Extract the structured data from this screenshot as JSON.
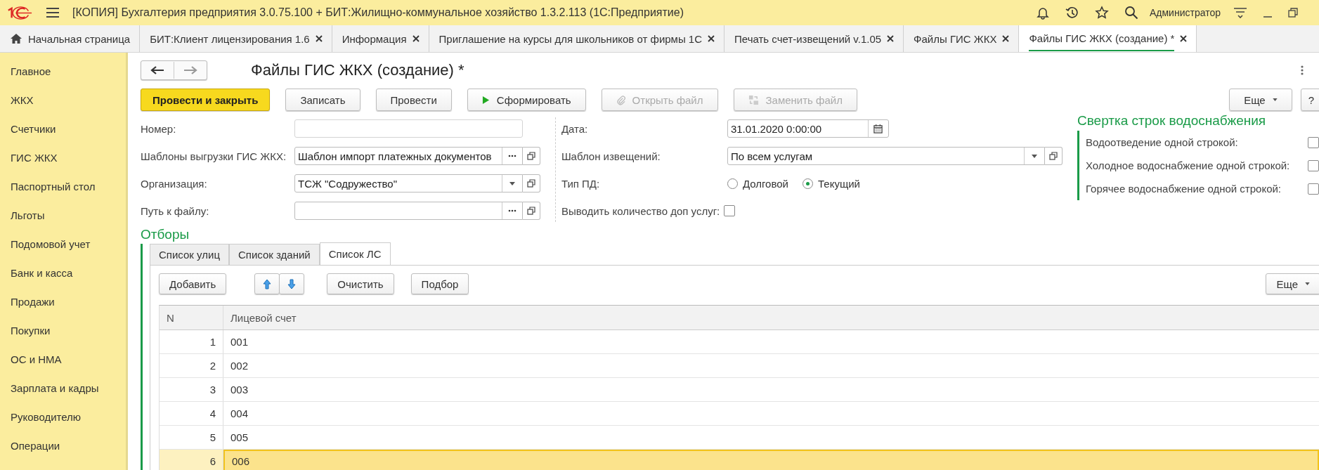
{
  "title_bar": {
    "title": "[КОПИЯ] Бухгалтерия предприятия 3.0.75.100 + БИТ:Жилищно-коммунальное хозяйство 1.3.2.113  (1С:Предприятие)",
    "user": "Администратор"
  },
  "tabs": [
    {
      "label": "Начальная страница",
      "kind": "home",
      "selected": false
    },
    {
      "label": "БИТ:Клиент лицензирования 1.6",
      "kind": "doc",
      "selected": false
    },
    {
      "label": "Информация",
      "kind": "doc",
      "selected": false
    },
    {
      "label": "Приглашение на курсы для школьников от фирмы 1С",
      "kind": "doc",
      "selected": false
    },
    {
      "label": "Печать счет-извещений v.1.05",
      "kind": "doc",
      "selected": false
    },
    {
      "label": "Файлы ГИС ЖКХ",
      "kind": "doc",
      "selected": false
    },
    {
      "label": "Файлы ГИС ЖКХ (создание) *",
      "kind": "doc",
      "selected": true
    }
  ],
  "sidebar": {
    "items": [
      {
        "label": "Главное"
      },
      {
        "label": "ЖКХ"
      },
      {
        "label": "Счетчики"
      },
      {
        "label": "ГИС ЖКХ"
      },
      {
        "label": "Паспортный стол"
      },
      {
        "label": "Льготы"
      },
      {
        "label": "Подомовой учет"
      },
      {
        "label": "Банк и касса"
      },
      {
        "label": "Продажи"
      },
      {
        "label": "Покупки"
      },
      {
        "label": "ОС и НМА"
      },
      {
        "label": "Зарплата и кадры"
      },
      {
        "label": "Руководителю"
      },
      {
        "label": "Операции"
      }
    ]
  },
  "form": {
    "title": "Файлы ГИС ЖКХ (создание) *",
    "buttons": [
      {
        "label": "Провести и закрыть",
        "kind": "primary",
        "disabled": false
      },
      {
        "label": "Записать",
        "kind": "plain",
        "disabled": false
      },
      {
        "label": "Провести",
        "kind": "plain",
        "disabled": false
      },
      {
        "label": "Сформировать",
        "kind": "play",
        "disabled": false
      },
      {
        "label": "Открыть файл",
        "kind": "attach",
        "disabled": true
      },
      {
        "label": "Заменить файл",
        "kind": "replace",
        "disabled": true
      }
    ],
    "more": "Еще",
    "help": "?",
    "left_fields": [
      {
        "label": "Номер:",
        "kind": "text"
      },
      {
        "label": "Шаблоны выгрузки ГИС ЖКХ:",
        "kind": "choice",
        "value": "Шаблон импорт платежных документов"
      },
      {
        "label": "Организация:",
        "kind": "select",
        "value": "ТСЖ \"Содружество\""
      },
      {
        "label": "Путь к файлу:",
        "kind": "choice"
      }
    ],
    "date": {
      "label": "Дата:",
      "value": "31.01.2020  0:00:00"
    },
    "notice_template": {
      "label": "Шаблон извещений:",
      "value": "По всем услугам"
    },
    "pd_type": {
      "label": "Тип ПД:",
      "options": [
        {
          "label": "Долговой",
          "selected": false
        },
        {
          "label": "Текущий",
          "selected": true
        }
      ]
    },
    "extra_count": {
      "label": "Выводить количество доп услуг:",
      "checked": false
    },
    "water_group": {
      "title": "Свертка строк водоснабжения",
      "options": [
        {
          "label": "Водоотведение одной строкой:",
          "checked": false
        },
        {
          "label": "Холодное водоснабжение одной строкой:",
          "checked": false
        },
        {
          "label": "Горячее водоснабжение одной строкой:",
          "checked": false
        }
      ]
    }
  },
  "filters": {
    "title": "Отборы",
    "tabs": [
      {
        "label": "Список улиц",
        "selected": false
      },
      {
        "label": "Список зданий",
        "selected": false
      },
      {
        "label": "Список ЛС",
        "selected": true
      }
    ],
    "toolbar": [
      {
        "label": "Добавить",
        "kind": "text"
      },
      {
        "kind": "up"
      },
      {
        "kind": "down"
      },
      {
        "label": "Очистить",
        "kind": "text"
      },
      {
        "label": "Подбор",
        "kind": "text"
      }
    ],
    "more": "Еще",
    "table": {
      "columns": [
        "N",
        "Лицевой счет"
      ],
      "rows": [
        {
          "n": "1",
          "account": "001",
          "selected": false
        },
        {
          "n": "2",
          "account": "002",
          "selected": false
        },
        {
          "n": "3",
          "account": "003",
          "selected": false
        },
        {
          "n": "4",
          "account": "004",
          "selected": false
        },
        {
          "n": "5",
          "account": "005",
          "selected": false
        },
        {
          "n": "6",
          "account": "006",
          "selected": true
        }
      ]
    }
  }
}
